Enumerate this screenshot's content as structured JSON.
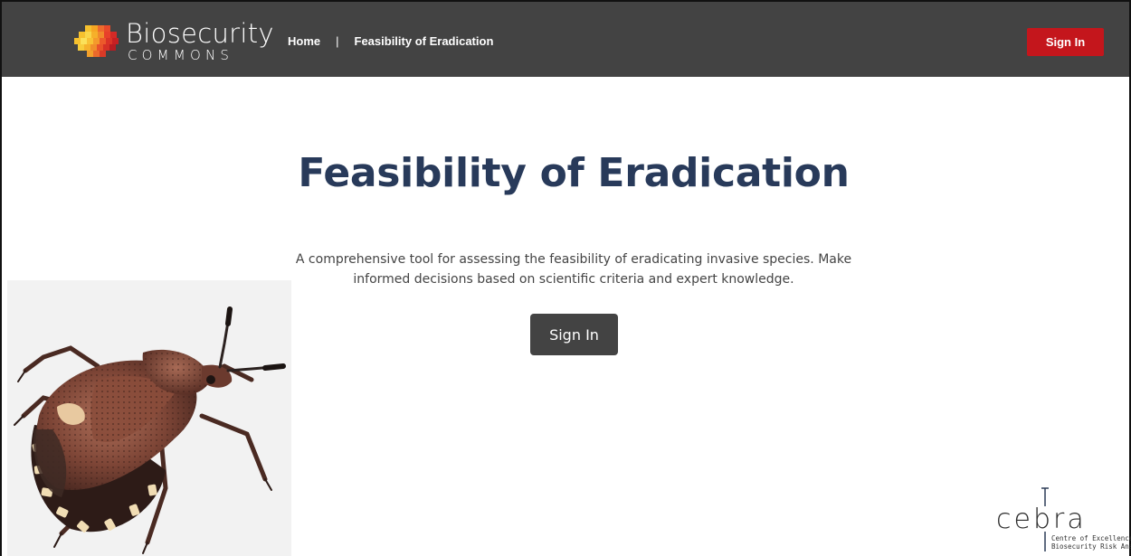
{
  "navbar": {
    "logo": {
      "word_top": "Biosecurity",
      "word_bottom": "COMMONS"
    },
    "links": [
      {
        "label": "Home"
      },
      {
        "label": "Feasibility of Eradication"
      }
    ],
    "separator": "|",
    "sign_in_label": "Sign In",
    "background_color": "#434343",
    "accent_color": "#c4161c"
  },
  "hero": {
    "title": "Feasibility of Eradication",
    "description": "A comprehensive tool for assessing the feasibility of eradicating invasive species. Make informed decisions based on scientific criteria and expert knowledge.",
    "sign_in_label": "Sign In",
    "title_color": "#283a5a"
  },
  "illustration": {
    "icon": "stink-bug-icon"
  },
  "cebra": {
    "wordmark": "cebra",
    "subtitle_line1": "Centre of Excellence for",
    "subtitle_line2": "Biosecurity Risk Analysis"
  }
}
